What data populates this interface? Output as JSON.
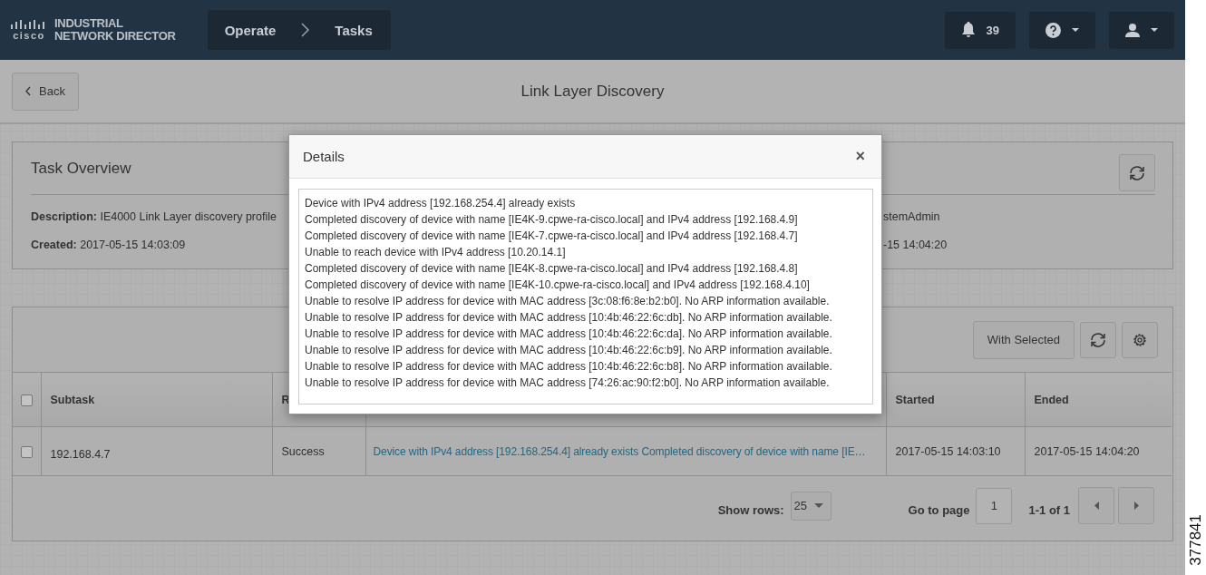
{
  "header": {
    "logo_wordmark": "cisco",
    "product_name_line1": "INDUSTRIAL",
    "product_name_line2": "NETWORK DIRECTOR",
    "breadcrumb": [
      "Operate",
      "Tasks"
    ],
    "notifications_count": "39"
  },
  "toolbar": {
    "back_button": "Back",
    "page_title": "Link Layer Discovery"
  },
  "task_overview": {
    "title": "Task Overview",
    "fields_left": [
      {
        "label": "Description:",
        "value": "IE4000 Link Layer discovery profile"
      },
      {
        "label": "Created:",
        "value": "2017-05-15 14:03:09"
      }
    ],
    "fields_right": [
      "stemAdmin",
      "-15 14:04:20"
    ]
  },
  "table": {
    "with_selected_button": "With Selected",
    "header_checked": false,
    "columns": [
      "Subtask",
      "R",
      "",
      "Started",
      "Ended"
    ],
    "rows": [
      {
        "checked": false,
        "cells": [
          "192.168.4.7",
          "Success",
          "Device with IPv4 address [192.168.254.4] already exists Completed discovery of device with name [IE…",
          "2017-05-15 14:03:10",
          "2017-05-15 14:04:20"
        ]
      }
    ]
  },
  "pagination": {
    "show_rows_label": "Show rows:",
    "rows_value": "25",
    "go_to_page_label": "Go to page",
    "page_value": "1",
    "range": "1-1 of 1"
  },
  "modal": {
    "title": "Details",
    "close": "×",
    "lines": [
      "Device with IPv4 address [192.168.254.4] already exists",
      "Completed discovery of device with name [IE4K-9.cpwe-ra-cisco.local] and IPv4 address [192.168.4.9]",
      "Completed discovery of device with name [IE4K-7.cpwe-ra-cisco.local] and IPv4 address [192.168.4.7]",
      "Unable to reach device with IPv4 address [10.20.14.1]",
      "Completed discovery of device with name [IE4K-8.cpwe-ra-cisco.local] and IPv4 address [192.168.4.8]",
      "Completed discovery of device with name [IE4K-10.cpwe-ra-cisco.local] and IPv4 address [192.168.4.10]",
      "Unable to resolve IP address for device with MAC address [3c:08:f6:8e:b2:b0]. No ARP information available.",
      "Unable to resolve IP address for device with MAC address [10:4b:46:22:6c:db]. No ARP information available.",
      "Unable to resolve IP address for device with MAC address [10:4b:46:22:6c:da]. No ARP information available.",
      "Unable to resolve IP address for device with MAC address [10:4b:46:22:6c:b9]. No ARP information available.",
      "Unable to resolve IP address for device with MAC address [10:4b:46:22:6c:b8]. No ARP information available.",
      "Unable to resolve IP address for device with MAC address [74:26:ac:90:f2:b0]. No ARP information available."
    ]
  },
  "figure_number": "377841"
}
